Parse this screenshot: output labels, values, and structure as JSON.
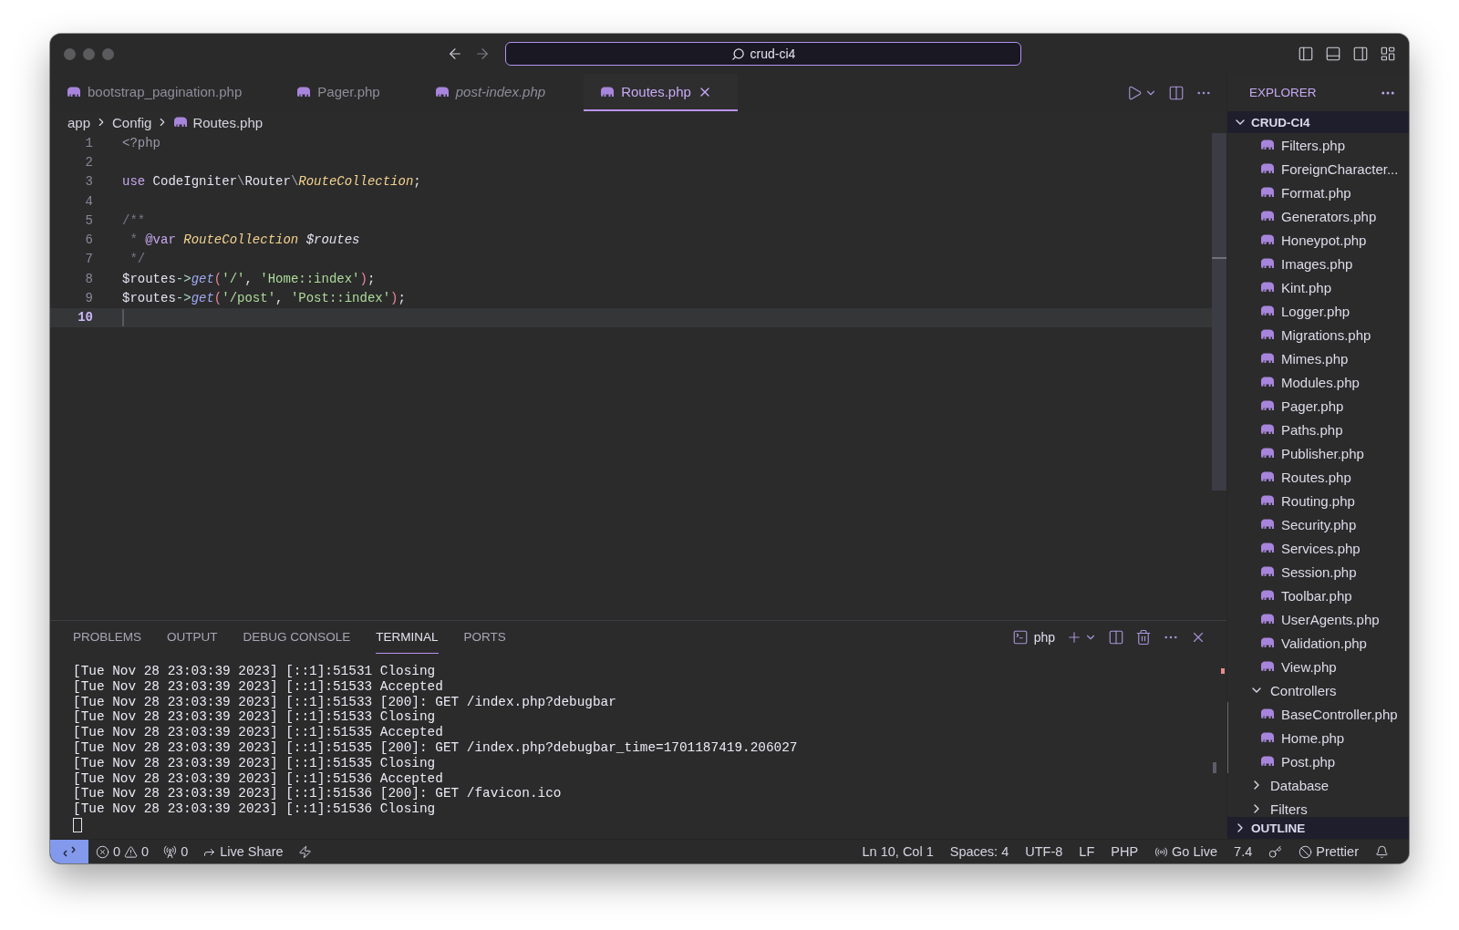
{
  "window": {
    "search": "crud-ci4"
  },
  "editor_tabs": [
    {
      "label": "bootstrap_pagination.php",
      "selected": false,
      "italic": false
    },
    {
      "label": "Pager.php",
      "selected": false,
      "italic": false
    },
    {
      "label": "post-index.php",
      "selected": false,
      "italic": true
    },
    {
      "label": "Routes.php",
      "selected": true,
      "italic": false
    }
  ],
  "breadcrumb": [
    {
      "kind": "folder",
      "label": "app"
    },
    {
      "kind": "folder",
      "label": "Config"
    },
    {
      "kind": "file",
      "label": "Routes.php"
    }
  ],
  "code_lines": [
    {
      "number": "1",
      "current": false,
      "tokens": [
        {
          "kind": "tag",
          "text": "<?php"
        }
      ]
    },
    {
      "number": "2",
      "current": false
    },
    {
      "number": "3",
      "current": false,
      "tokens": [
        {
          "kind": "keyword",
          "text": "use"
        },
        {
          "kind": "plain",
          "text": " CodeIgniter"
        },
        {
          "kind": "punct",
          "text": "\\"
        },
        {
          "kind": "plain",
          "text": "Router"
        },
        {
          "kind": "punct",
          "text": "\\"
        },
        {
          "kind": "class",
          "text": "RouteCollection"
        },
        {
          "kind": "plain",
          "text": ";"
        }
      ]
    },
    {
      "number": "4",
      "current": false
    },
    {
      "number": "5",
      "current": false,
      "tokens": [
        {
          "kind": "comment",
          "text": "/**"
        }
      ]
    },
    {
      "number": "6",
      "current": false,
      "tokens": [
        {
          "kind": "comment",
          "text": " * "
        },
        {
          "kind": "doctag",
          "text": "@var"
        },
        {
          "kind": "class",
          "text": " RouteCollection"
        },
        {
          "kind": "italicvar",
          "text": " $routes"
        }
      ]
    },
    {
      "number": "7",
      "current": false,
      "tokens": [
        {
          "kind": "comment",
          "text": " */"
        }
      ]
    },
    {
      "number": "8",
      "current": false,
      "tokens": [
        {
          "kind": "plain",
          "text": "$routes"
        },
        {
          "kind": "op",
          "text": "->"
        },
        {
          "kind": "fn",
          "text": "get"
        },
        {
          "kind": "paren",
          "text": "("
        },
        {
          "kind": "string",
          "text": "'/'"
        },
        {
          "kind": "plain",
          "text": ", "
        },
        {
          "kind": "string",
          "text": "'Home::index'"
        },
        {
          "kind": "paren",
          "text": ")"
        },
        {
          "kind": "plain",
          "text": ";"
        }
      ]
    },
    {
      "number": "9",
      "current": false,
      "tokens": [
        {
          "kind": "plain",
          "text": "$routes"
        },
        {
          "kind": "op",
          "text": "->"
        },
        {
          "kind": "fn",
          "text": "get"
        },
        {
          "kind": "paren",
          "text": "("
        },
        {
          "kind": "string",
          "text": "'/post'"
        },
        {
          "kind": "plain",
          "text": ", "
        },
        {
          "kind": "string",
          "text": "'Post::index'"
        },
        {
          "kind": "paren",
          "text": ")"
        },
        {
          "kind": "plain",
          "text": ";"
        }
      ]
    },
    {
      "number": "10",
      "current": true
    }
  ],
  "explorer": {
    "title": "EXPLORER",
    "root": {
      "label": "CRUD-CI4",
      "expanded": true,
      "children": [
        {
          "kind": "file",
          "label": "Filters.php"
        },
        {
          "kind": "file",
          "label": "ForeignCharacter..."
        },
        {
          "kind": "file",
          "label": "Format.php"
        },
        {
          "kind": "file",
          "label": "Generators.php"
        },
        {
          "kind": "file",
          "label": "Honeypot.php"
        },
        {
          "kind": "file",
          "label": "Images.php"
        },
        {
          "kind": "file",
          "label": "Kint.php"
        },
        {
          "kind": "file",
          "label": "Logger.php"
        },
        {
          "kind": "file",
          "label": "Migrations.php"
        },
        {
          "kind": "file",
          "label": "Mimes.php"
        },
        {
          "kind": "file",
          "label": "Modules.php"
        },
        {
          "kind": "file",
          "label": "Pager.php"
        },
        {
          "kind": "file",
          "label": "Paths.php"
        },
        {
          "kind": "file",
          "label": "Publisher.php"
        },
        {
          "kind": "file",
          "label": "Routes.php"
        },
        {
          "kind": "file",
          "label": "Routing.php"
        },
        {
          "kind": "file",
          "label": "Security.php"
        },
        {
          "kind": "file",
          "label": "Services.php"
        },
        {
          "kind": "file",
          "label": "Session.php"
        },
        {
          "kind": "file",
          "label": "Toolbar.php"
        },
        {
          "kind": "file",
          "label": "UserAgents.php"
        },
        {
          "kind": "file",
          "label": "Validation.php"
        },
        {
          "kind": "file",
          "label": "View.php"
        },
        {
          "kind": "folder",
          "label": "Controllers",
          "expanded": true,
          "children": [
            {
              "kind": "file",
              "label": "BaseController.php"
            },
            {
              "kind": "file",
              "label": "Home.php"
            },
            {
              "kind": "file",
              "label": "Post.php"
            }
          ]
        },
        {
          "kind": "folder",
          "label": "Database",
          "expanded": false
        },
        {
          "kind": "folder",
          "label": "Filters",
          "expanded": false
        }
      ]
    },
    "outline": {
      "label": "OUTLINE",
      "expanded": false
    }
  },
  "panel": {
    "tabs": [
      {
        "label": "PROBLEMS",
        "selected": false
      },
      {
        "label": "OUTPUT",
        "selected": false
      },
      {
        "label": "DEBUG CONSOLE",
        "selected": false
      },
      {
        "label": "TERMINAL",
        "selected": true
      },
      {
        "label": "PORTS",
        "selected": false
      }
    ],
    "terminal_name": "php",
    "lines": [
      "[Tue Nov 28 23:03:39 2023] [::1]:51531 Closing",
      "[Tue Nov 28 23:03:39 2023] [::1]:51533 Accepted",
      "[Tue Nov 28 23:03:39 2023] [::1]:51533 [200]: GET /index.php?debugbar",
      "[Tue Nov 28 23:03:39 2023] [::1]:51533 Closing",
      "[Tue Nov 28 23:03:39 2023] [::1]:51535 Accepted",
      "[Tue Nov 28 23:03:39 2023] [::1]:51535 [200]: GET /index.php?debugbar_time=1701187419.206027",
      "[Tue Nov 28 23:03:39 2023] [::1]:51535 Closing",
      "[Tue Nov 28 23:03:39 2023] [::1]:51536 Accepted",
      "[Tue Nov 28 23:03:39 2023] [::1]:51536 [200]: GET /favicon.ico",
      "[Tue Nov 28 23:03:39 2023] [::1]:51536 Closing"
    ]
  },
  "status_bar": {
    "left": [
      {
        "kind": "remote"
      },
      {
        "kind": "problems",
        "errors": "0",
        "warnings": "0"
      },
      {
        "kind": "ports",
        "text": "0"
      },
      {
        "kind": "live-share",
        "text": "Live Share"
      },
      {
        "kind": "lightning"
      }
    ],
    "right": [
      {
        "kind": "text",
        "text": "Ln 10, Col 1"
      },
      {
        "kind": "text",
        "text": "Spaces: 4"
      },
      {
        "kind": "text",
        "text": "UTF-8"
      },
      {
        "kind": "text",
        "text": "LF"
      },
      {
        "kind": "text",
        "text": "PHP"
      },
      {
        "kind": "go-live",
        "text": "Go Live"
      },
      {
        "kind": "text",
        "text": "7.4"
      },
      {
        "kind": "key"
      },
      {
        "kind": "prettier",
        "text": "Prettier"
      },
      {
        "kind": "bell"
      }
    ]
  }
}
